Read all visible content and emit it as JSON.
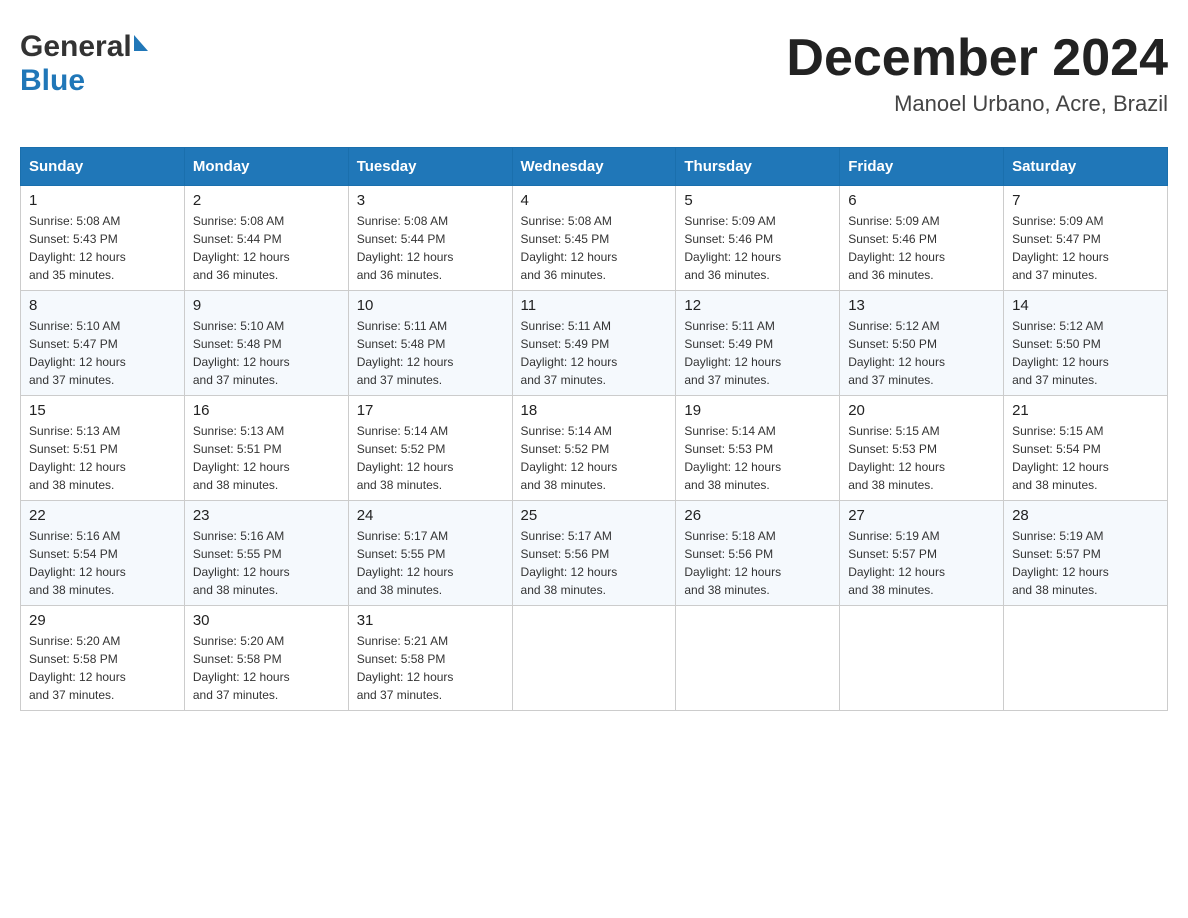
{
  "header": {
    "logo_general": "General",
    "logo_blue": "Blue",
    "month_title": "December 2024",
    "location": "Manoel Urbano, Acre, Brazil"
  },
  "days_of_week": [
    "Sunday",
    "Monday",
    "Tuesday",
    "Wednesday",
    "Thursday",
    "Friday",
    "Saturday"
  ],
  "weeks": [
    [
      {
        "day": "1",
        "sunrise": "5:08 AM",
        "sunset": "5:43 PM",
        "daylight": "12 hours and 35 minutes."
      },
      {
        "day": "2",
        "sunrise": "5:08 AM",
        "sunset": "5:44 PM",
        "daylight": "12 hours and 36 minutes."
      },
      {
        "day": "3",
        "sunrise": "5:08 AM",
        "sunset": "5:44 PM",
        "daylight": "12 hours and 36 minutes."
      },
      {
        "day": "4",
        "sunrise": "5:08 AM",
        "sunset": "5:45 PM",
        "daylight": "12 hours and 36 minutes."
      },
      {
        "day": "5",
        "sunrise": "5:09 AM",
        "sunset": "5:46 PM",
        "daylight": "12 hours and 36 minutes."
      },
      {
        "day": "6",
        "sunrise": "5:09 AM",
        "sunset": "5:46 PM",
        "daylight": "12 hours and 36 minutes."
      },
      {
        "day": "7",
        "sunrise": "5:09 AM",
        "sunset": "5:47 PM",
        "daylight": "12 hours and 37 minutes."
      }
    ],
    [
      {
        "day": "8",
        "sunrise": "5:10 AM",
        "sunset": "5:47 PM",
        "daylight": "12 hours and 37 minutes."
      },
      {
        "day": "9",
        "sunrise": "5:10 AM",
        "sunset": "5:48 PM",
        "daylight": "12 hours and 37 minutes."
      },
      {
        "day": "10",
        "sunrise": "5:11 AM",
        "sunset": "5:48 PM",
        "daylight": "12 hours and 37 minutes."
      },
      {
        "day": "11",
        "sunrise": "5:11 AM",
        "sunset": "5:49 PM",
        "daylight": "12 hours and 37 minutes."
      },
      {
        "day": "12",
        "sunrise": "5:11 AM",
        "sunset": "5:49 PM",
        "daylight": "12 hours and 37 minutes."
      },
      {
        "day": "13",
        "sunrise": "5:12 AM",
        "sunset": "5:50 PM",
        "daylight": "12 hours and 37 minutes."
      },
      {
        "day": "14",
        "sunrise": "5:12 AM",
        "sunset": "5:50 PM",
        "daylight": "12 hours and 37 minutes."
      }
    ],
    [
      {
        "day": "15",
        "sunrise": "5:13 AM",
        "sunset": "5:51 PM",
        "daylight": "12 hours and 38 minutes."
      },
      {
        "day": "16",
        "sunrise": "5:13 AM",
        "sunset": "5:51 PM",
        "daylight": "12 hours and 38 minutes."
      },
      {
        "day": "17",
        "sunrise": "5:14 AM",
        "sunset": "5:52 PM",
        "daylight": "12 hours and 38 minutes."
      },
      {
        "day": "18",
        "sunrise": "5:14 AM",
        "sunset": "5:52 PM",
        "daylight": "12 hours and 38 minutes."
      },
      {
        "day": "19",
        "sunrise": "5:14 AM",
        "sunset": "5:53 PM",
        "daylight": "12 hours and 38 minutes."
      },
      {
        "day": "20",
        "sunrise": "5:15 AM",
        "sunset": "5:53 PM",
        "daylight": "12 hours and 38 minutes."
      },
      {
        "day": "21",
        "sunrise": "5:15 AM",
        "sunset": "5:54 PM",
        "daylight": "12 hours and 38 minutes."
      }
    ],
    [
      {
        "day": "22",
        "sunrise": "5:16 AM",
        "sunset": "5:54 PM",
        "daylight": "12 hours and 38 minutes."
      },
      {
        "day": "23",
        "sunrise": "5:16 AM",
        "sunset": "5:55 PM",
        "daylight": "12 hours and 38 minutes."
      },
      {
        "day": "24",
        "sunrise": "5:17 AM",
        "sunset": "5:55 PM",
        "daylight": "12 hours and 38 minutes."
      },
      {
        "day": "25",
        "sunrise": "5:17 AM",
        "sunset": "5:56 PM",
        "daylight": "12 hours and 38 minutes."
      },
      {
        "day": "26",
        "sunrise": "5:18 AM",
        "sunset": "5:56 PM",
        "daylight": "12 hours and 38 minutes."
      },
      {
        "day": "27",
        "sunrise": "5:19 AM",
        "sunset": "5:57 PM",
        "daylight": "12 hours and 38 minutes."
      },
      {
        "day": "28",
        "sunrise": "5:19 AM",
        "sunset": "5:57 PM",
        "daylight": "12 hours and 38 minutes."
      }
    ],
    [
      {
        "day": "29",
        "sunrise": "5:20 AM",
        "sunset": "5:58 PM",
        "daylight": "12 hours and 37 minutes."
      },
      {
        "day": "30",
        "sunrise": "5:20 AM",
        "sunset": "5:58 PM",
        "daylight": "12 hours and 37 minutes."
      },
      {
        "day": "31",
        "sunrise": "5:21 AM",
        "sunset": "5:58 PM",
        "daylight": "12 hours and 37 minutes."
      },
      null,
      null,
      null,
      null
    ]
  ],
  "labels": {
    "sunrise": "Sunrise:",
    "sunset": "Sunset:",
    "daylight": "Daylight:"
  }
}
